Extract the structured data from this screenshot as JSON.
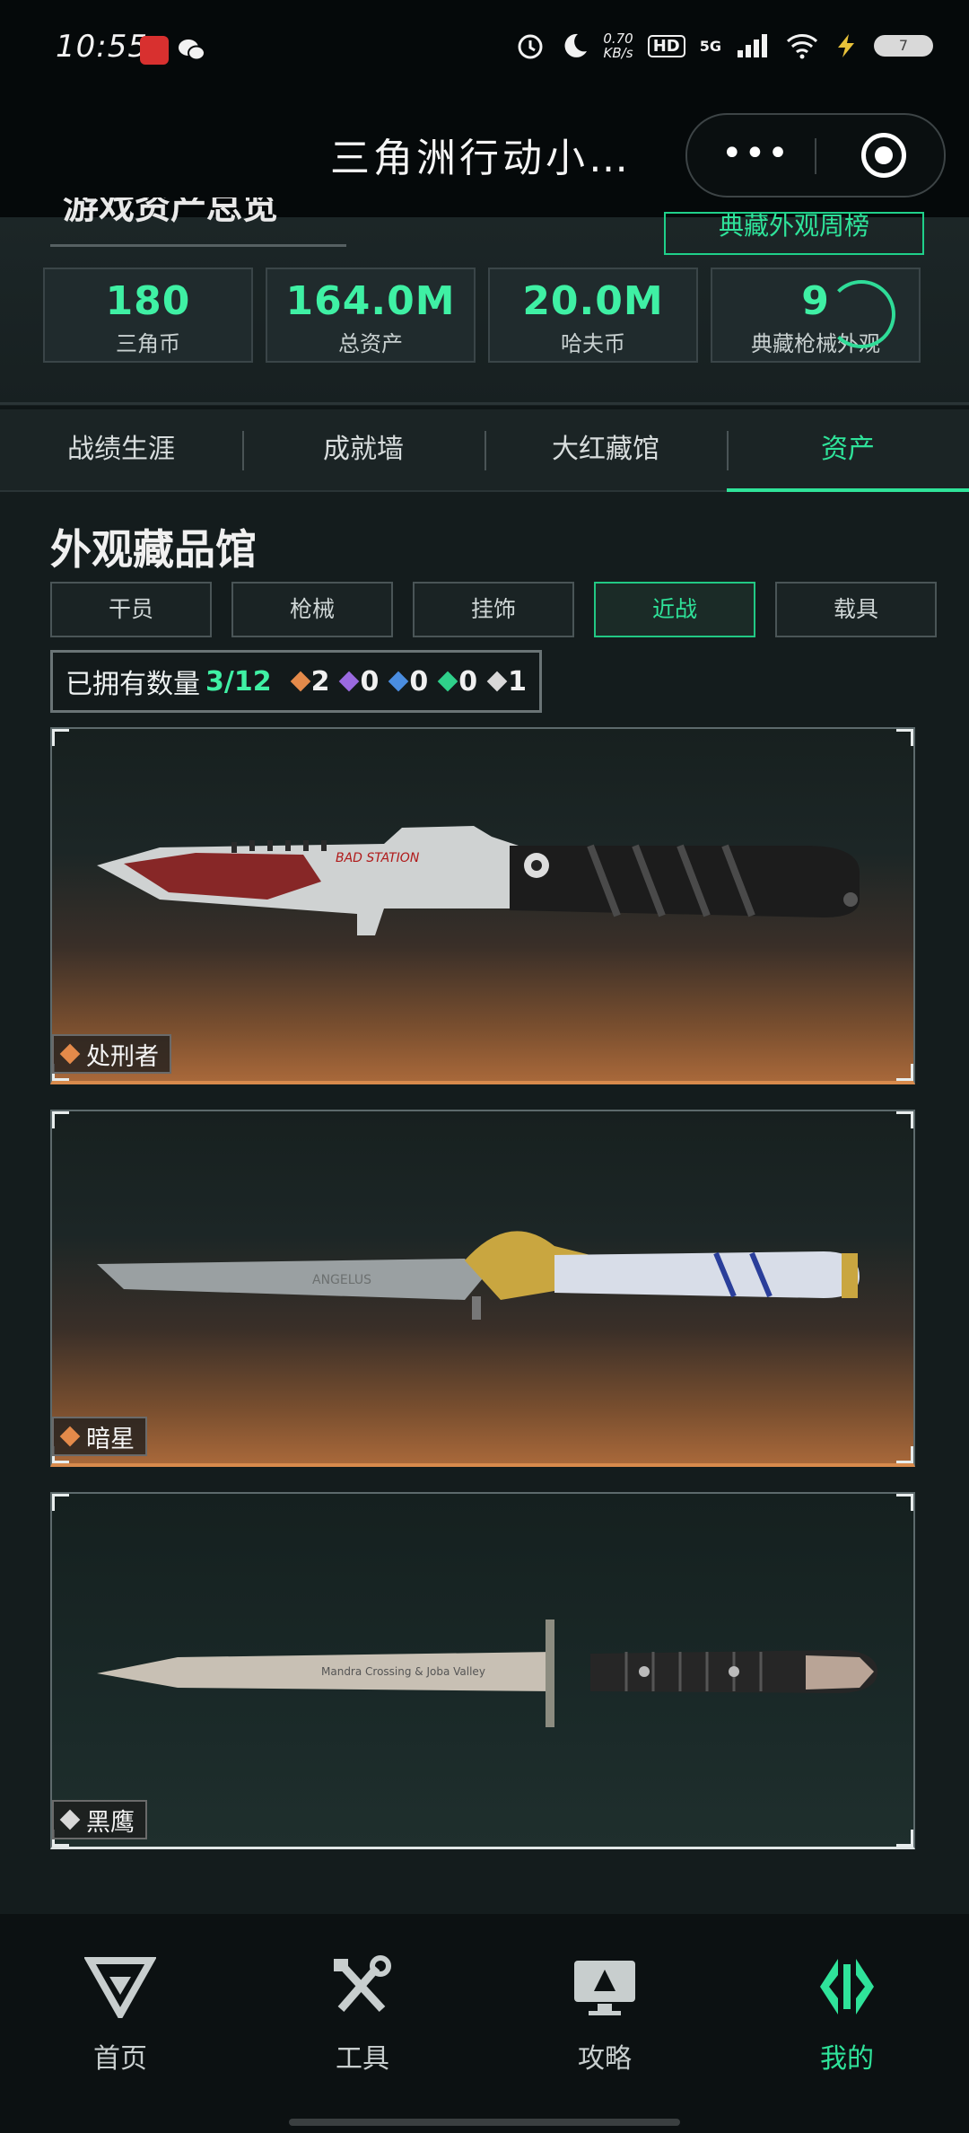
{
  "status_bar": {
    "time": "10:55",
    "net_speed_value": "0.70",
    "net_speed_unit": "KB/s",
    "hd": "HD",
    "network": "5G",
    "battery": "7",
    "icons": [
      "app-badge-icon",
      "wechat-icon",
      "alarm-icon",
      "moon-icon",
      "signal-icon",
      "wifi-icon",
      "charging-icon",
      "battery-icon"
    ]
  },
  "title_bar": {
    "title": "三角洲行动小…",
    "more_label": "•••"
  },
  "overview": {
    "title": "游戏资产总览",
    "rank_button": "典藏外观周榜",
    "stats": [
      {
        "value": "180",
        "label": "三角币"
      },
      {
        "value": "164.0M",
        "label": "总资产"
      },
      {
        "value": "20.0M",
        "label": "哈夫币"
      },
      {
        "value": "9",
        "label": "典藏枪械外观"
      }
    ]
  },
  "tabs": [
    {
      "label": "战绩生涯",
      "active": false
    },
    {
      "label": "成就墙",
      "active": false
    },
    {
      "label": "大红藏馆",
      "active": false
    },
    {
      "label": "资产",
      "active": true
    }
  ],
  "collection": {
    "title": "外观藏品馆",
    "categories": [
      {
        "label": "干员",
        "active": false
      },
      {
        "label": "枪械",
        "active": false
      },
      {
        "label": "挂饰",
        "active": false
      },
      {
        "label": "近战",
        "active": true
      },
      {
        "label": "载具",
        "active": false
      }
    ],
    "owned_label": "已拥有数量",
    "owned_count": "3/12",
    "rarity_counts": [
      {
        "color": "#e48a4a",
        "count": "2"
      },
      {
        "color": "#9a6ae0",
        "count": "0"
      },
      {
        "color": "#4a8de0",
        "count": "0"
      },
      {
        "color": "#2fd08a",
        "count": "0"
      },
      {
        "color": "#d8d8d8",
        "count": "1"
      }
    ],
    "items": [
      {
        "name": "处刑者",
        "rarity_color": "#e48a4a",
        "blade_text": "BAD STATION"
      },
      {
        "name": "暗星",
        "rarity_color": "#e48a4a",
        "blade_text": "ANGELUS"
      },
      {
        "name": "黑鹰",
        "rarity_color": "#d8d8d8",
        "blade_text": "Mandra Crossing & Joba Valley"
      }
    ]
  },
  "bottom_nav": [
    {
      "label": "首页",
      "icon": "delta-logo-icon",
      "active": false
    },
    {
      "label": "工具",
      "icon": "tools-icon",
      "active": false
    },
    {
      "label": "攻略",
      "icon": "monitor-icon",
      "active": false
    },
    {
      "label": "我的",
      "icon": "profile-logo-icon",
      "active": true
    }
  ]
}
